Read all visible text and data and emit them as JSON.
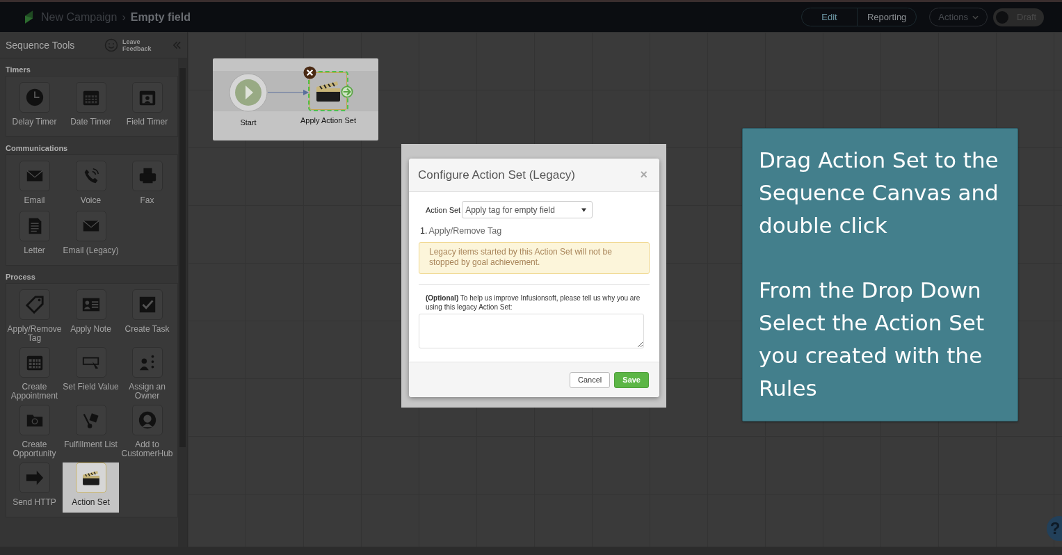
{
  "header": {
    "breadcrumb": [
      {
        "label": "New Campaign",
        "current": false
      },
      {
        "label": "Empty field",
        "current": true
      }
    ],
    "separator": "›",
    "view_tabs": [
      {
        "label": "Edit",
        "selected": true
      },
      {
        "label": "Reporting",
        "selected": false
      }
    ],
    "actions_button": "Actions",
    "status_toggle": {
      "label": "Draft",
      "on": false
    }
  },
  "sidebar": {
    "title": "Sequence Tools",
    "feedback": "Leave Feedback",
    "sections": [
      {
        "title": "Timers",
        "tools": [
          {
            "label": "Delay Timer",
            "highlighted": false
          },
          {
            "label": "Date Timer",
            "highlighted": false
          },
          {
            "label": "Field Timer",
            "highlighted": false
          }
        ]
      },
      {
        "title": "Communications",
        "tools": [
          {
            "label": "Email",
            "highlighted": false
          },
          {
            "label": "Voice",
            "highlighted": false
          },
          {
            "label": "Fax",
            "highlighted": false
          },
          {
            "label": "Letter",
            "highlighted": false
          },
          {
            "label": "Email (Legacy)",
            "highlighted": false
          }
        ]
      },
      {
        "title": "Process",
        "tools": [
          {
            "label": "Apply/Remove Tag",
            "highlighted": false
          },
          {
            "label": "Apply Note",
            "highlighted": false
          },
          {
            "label": "Create Task",
            "highlighted": false
          },
          {
            "label": "Create Appointment",
            "highlighted": false
          },
          {
            "label": "Set Field Value",
            "highlighted": false
          },
          {
            "label": "Assign an Owner",
            "highlighted": false
          },
          {
            "label": "Create Opportunity",
            "highlighted": false
          },
          {
            "label": "Fulfillment List",
            "highlighted": false
          },
          {
            "label": "Add to CustomerHub",
            "highlighted": false
          },
          {
            "label": "Send HTTP",
            "highlighted": false
          },
          {
            "label": "Action Set",
            "highlighted": true
          }
        ]
      }
    ]
  },
  "canvas": {
    "nodes": [
      {
        "label": "Start",
        "kind": "start",
        "selected": false
      },
      {
        "label": "Apply Action Set",
        "kind": "action_set",
        "selected": true
      }
    ]
  },
  "dialog": {
    "title": "Configure Action Set (Legacy)",
    "close": "×",
    "field_label": "Action Set",
    "field_value": "Apply tag for empty field",
    "steps": [
      {
        "number": "1.",
        "label": "Apply/Remove Tag"
      }
    ],
    "warning": "Legacy items started by this Action Set will not be stopped by goal achievement.",
    "feedback_prompt": "**(Optional)** To help us improve Infusionsoft, please tell us why you are using this legacy Action Set:",
    "buttons": [
      {
        "label": "Cancel",
        "kind": "secondary"
      },
      {
        "label": "Save",
        "kind": "primary"
      }
    ]
  },
  "callout": {
    "paragraphs": [
      "Drag Action Set to the Sequence Canvas and double click",
      "From the Drop Down Select the Action Set you created with the Rules"
    ]
  },
  "help_button": "?"
}
